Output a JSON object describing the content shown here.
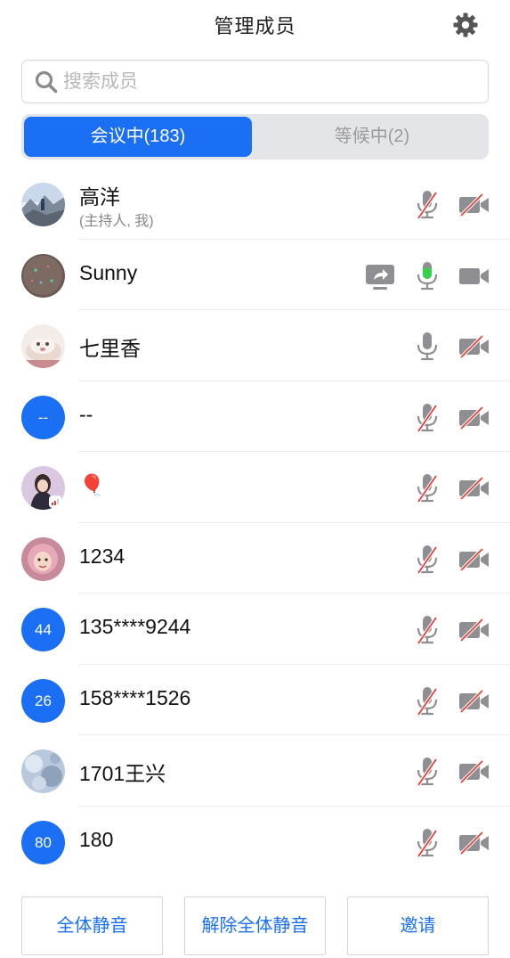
{
  "header": {
    "title": "管理成员",
    "settings_icon": "gear-icon"
  },
  "search": {
    "placeholder": "搜索成员",
    "value": "",
    "icon": "search-icon"
  },
  "tabs": [
    {
      "label": "会议中(183)",
      "active": true
    },
    {
      "label": "等候中(2)",
      "active": false
    }
  ],
  "members": [
    {
      "name": "高洋",
      "subtitle": "(主持人, 我)",
      "avatar": "photo",
      "mic": "muted",
      "camera": "off"
    },
    {
      "name": "Sunny",
      "avatar": "photo",
      "sharing": true,
      "mic": "speaking",
      "camera": "on"
    },
    {
      "name": "七里香",
      "avatar": "photo",
      "mic": "on",
      "camera": "off"
    },
    {
      "name": "--",
      "avatar_text": "--",
      "mic": "muted",
      "camera": "off"
    },
    {
      "name": "🎈",
      "avatar": "photo",
      "signal_badge": true,
      "mic": "muted",
      "camera": "off"
    },
    {
      "name": "1234",
      "avatar": "photo",
      "mic": "muted",
      "camera": "off"
    },
    {
      "name": "135****9244",
      "avatar_text": "44",
      "mic": "muted",
      "camera": "off"
    },
    {
      "name": "158****1526",
      "avatar_text": "26",
      "mic": "muted",
      "camera": "off"
    },
    {
      "name": "1701王兴",
      "avatar": "photo",
      "mic": "muted",
      "camera": "off"
    },
    {
      "name": "180",
      "avatar_text": "80",
      "mic": "muted",
      "camera": "off"
    }
  ],
  "footer": {
    "mute_all": "全体静音",
    "unmute_all": "解除全体静音",
    "invite": "邀请"
  },
  "colors": {
    "accent": "#1a6ff5",
    "muted_slash": "#e0413a",
    "speaking": "#35d14a",
    "icon_gray": "#8e8e93"
  }
}
